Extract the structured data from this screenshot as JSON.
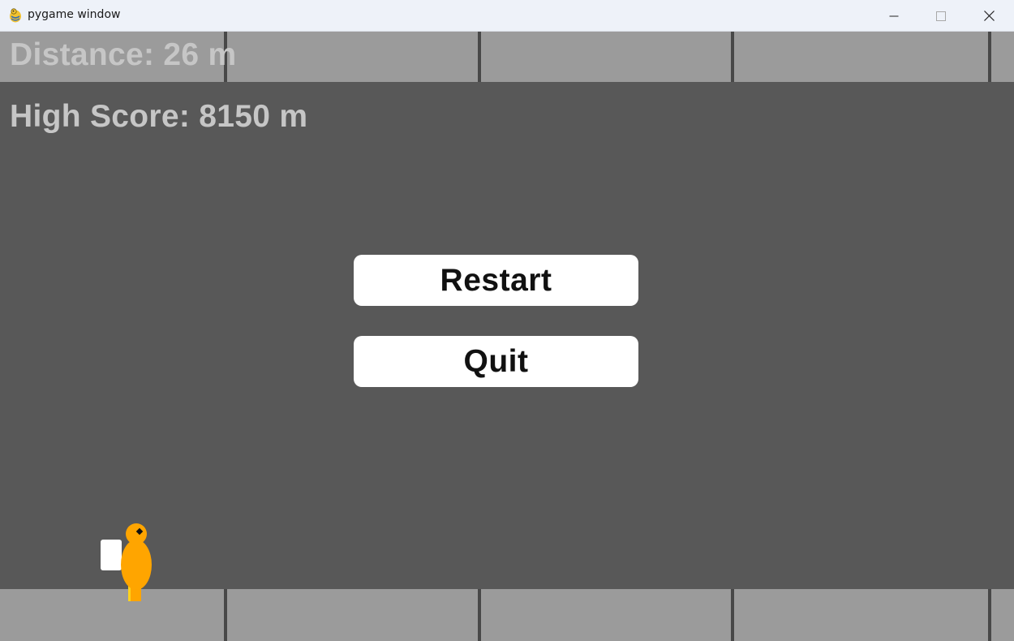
{
  "window": {
    "title": "pygame window",
    "icon": "pygame-snake-icon",
    "controls": {
      "minimize_icon": "minimize-icon",
      "maximize_icon": "maximize-icon",
      "close_icon": "close-icon"
    }
  },
  "hud": {
    "distance": "Distance: 26 m",
    "high_score": "High Score: 8150 m"
  },
  "menu": {
    "restart_label": "Restart",
    "quit_label": "Quit"
  },
  "colors": {
    "background": "#585858",
    "ceiling_floor": "#9b9b9b",
    "hud_text": "#c6c6c6",
    "button_bg": "#ffffff",
    "player": "#ffa500",
    "jetpack": "#ffffff"
  },
  "sprites": {
    "player": "player-jetpack-character"
  }
}
